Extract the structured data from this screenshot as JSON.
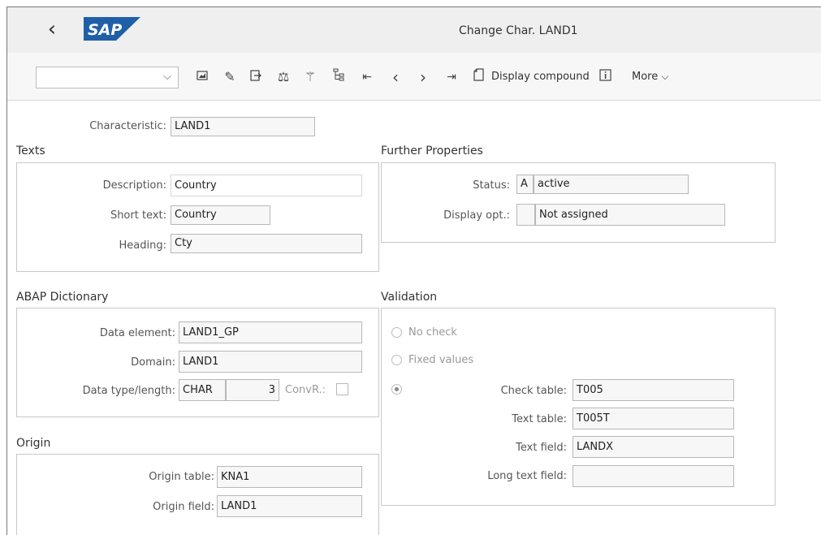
{
  "window": {
    "title": "Change Char. LAND1"
  },
  "toolbar": {
    "display_compound_label": "Display compound",
    "more_label": "More",
    "dropdown_value": ""
  },
  "characteristic": {
    "label": "Characteristic:",
    "value": "LAND1"
  },
  "texts": {
    "heading": "Texts",
    "description_label": "Description:",
    "description_value": "Country",
    "short_text_label": "Short text:",
    "short_text_value": "Country",
    "heading_label": "Heading:",
    "heading_value": "Cty"
  },
  "further_properties": {
    "heading": "Further Properties",
    "status_label": "Status:",
    "status_code": "A",
    "status_text": "active",
    "display_opt_label": "Display opt.:",
    "display_opt_code": "",
    "display_opt_text": "Not assigned"
  },
  "abap_dictionary": {
    "heading": "ABAP Dictionary",
    "data_element_label": "Data element:",
    "data_element_value": "LAND1_GP",
    "domain_label": "Domain:",
    "domain_value": "LAND1",
    "data_type_label": "Data type/length:",
    "data_type_value": "CHAR",
    "length_value": "3",
    "convr_label": "ConvR.:"
  },
  "validation": {
    "heading": "Validation",
    "no_check_label": "No check",
    "fixed_values_label": "Fixed values",
    "check_table_label": "Check table:",
    "check_table_value": "T005",
    "text_table_label": "Text table:",
    "text_table_value": "T005T",
    "text_field_label": "Text field:",
    "text_field_value": "LANDX",
    "long_text_field_label": "Long text field:",
    "long_text_field_value": ""
  },
  "origin": {
    "heading": "Origin",
    "origin_table_label": "Origin table:",
    "origin_table_value": "KNA1",
    "origin_field_label": "Origin field:",
    "origin_field_value": "LAND1"
  },
  "icons": [
    "back-icon",
    "sap-logo",
    "image-icon",
    "edit-icon",
    "export-icon",
    "balance-icon",
    "magic-wand-icon",
    "hierarchy-icon",
    "first-page-icon",
    "previous-icon",
    "next-icon",
    "last-page-icon",
    "document-icon",
    "info-icon",
    "chevron-down-icon"
  ]
}
